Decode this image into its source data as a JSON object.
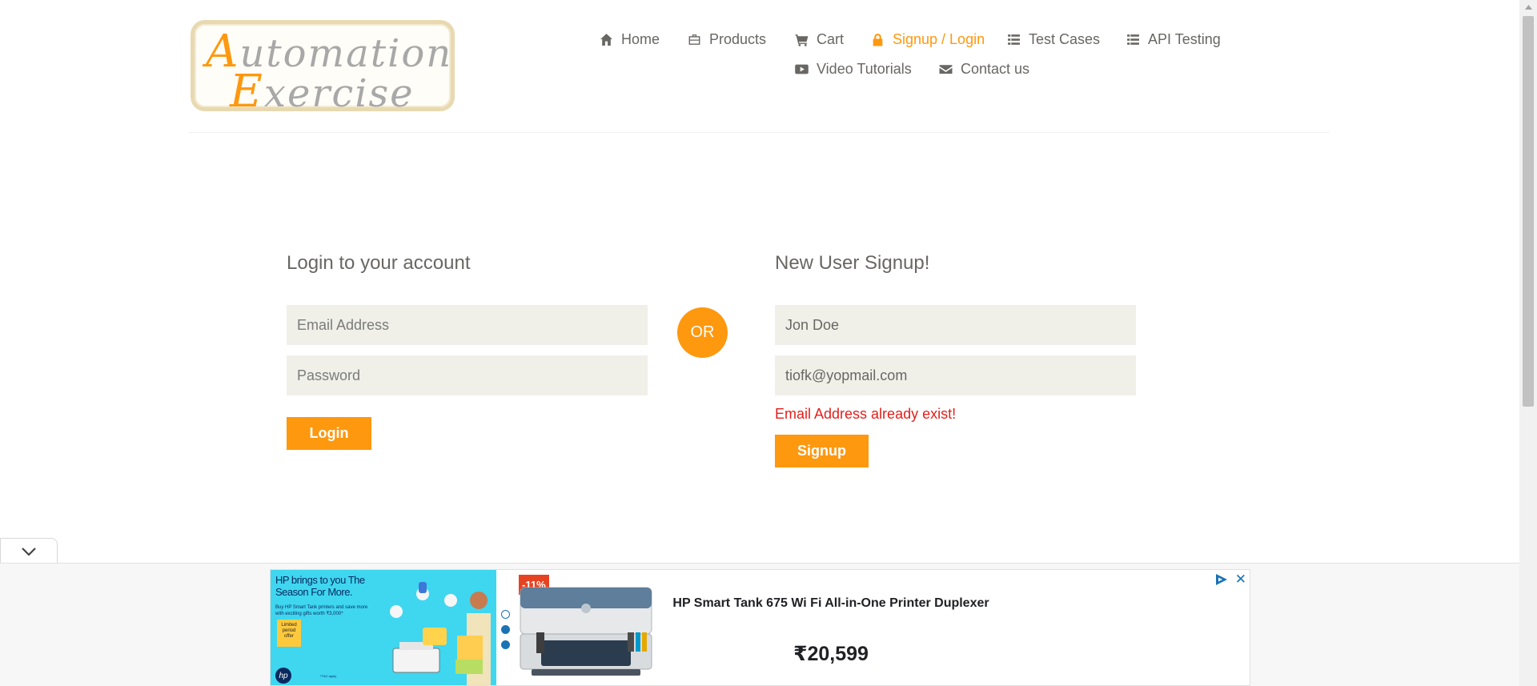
{
  "logo": {
    "line1_first": "A",
    "line1_rest": "utomation",
    "line2_first": "E",
    "line2_rest": "xercise"
  },
  "nav": {
    "home": "Home",
    "products": "Products",
    "cart": "Cart",
    "signup_login": "Signup / Login",
    "test_cases": "Test Cases",
    "api_testing": "API Testing",
    "video_tutorials": "Video Tutorials",
    "contact_us": "Contact us"
  },
  "login": {
    "title": "Login to your account",
    "email_placeholder": "Email Address",
    "password_placeholder": "Password",
    "button": "Login"
  },
  "or_label": "OR",
  "signup": {
    "title": "New User Signup!",
    "name_value": "Jon Doe",
    "email_value": "tiofk@yopmail.com",
    "error": "Email Address already exist!",
    "button": "Signup"
  },
  "ad": {
    "hp_headline": "HP brings to you The Season For More.",
    "hp_sub": "Buy HP Smart Tank printers and save more with exciting gifts worth ₹3,000*",
    "hp_tag": "Limited period offer",
    "hp_logo": "hp",
    "hp_fine": "*T&C apply",
    "discount": "-11%",
    "product_title": "HP Smart Tank 675 Wi Fi All-in-One Printer Duplexer",
    "price": "₹20,599",
    "close": "✕"
  },
  "colors": {
    "accent": "#fe980f",
    "error": "#e3201b",
    "field_bg": "#f0f0e9",
    "text": "#696763"
  }
}
